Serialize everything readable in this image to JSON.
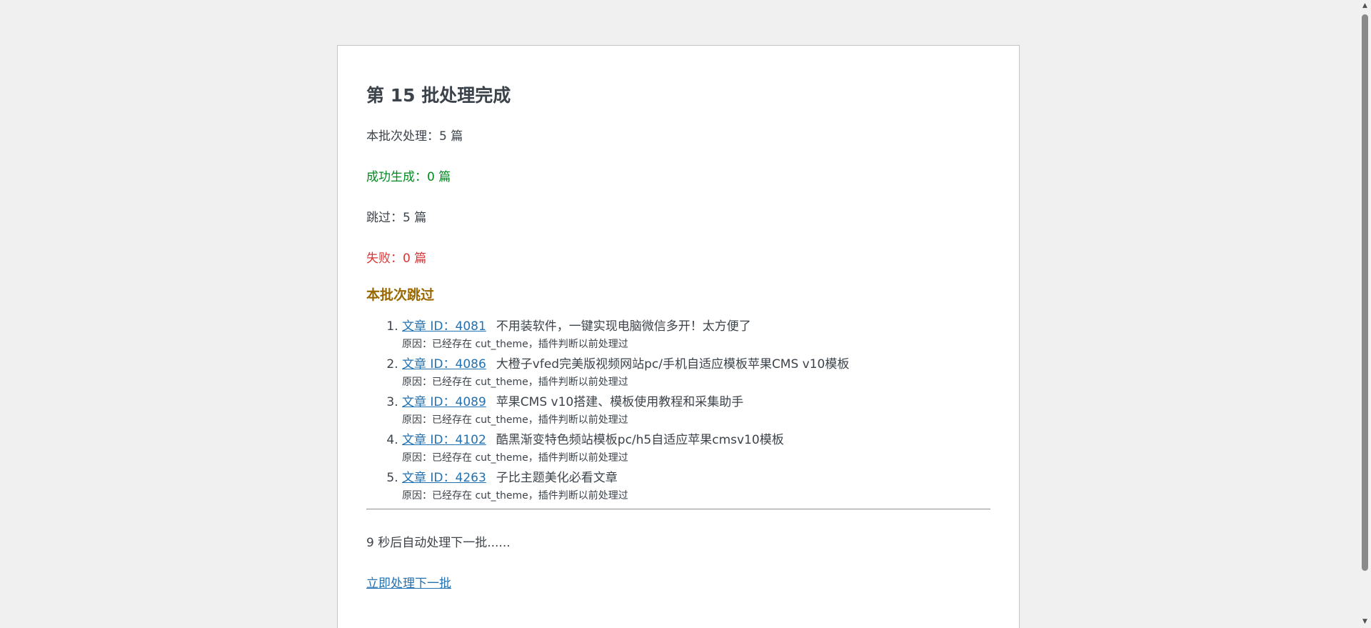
{
  "batch": {
    "title": "第 15 批处理完成",
    "processed": "本批次处理：5 篇",
    "success": "成功生成：0 篇",
    "skipped": "跳过：5 篇",
    "failed": "失败：0 篇"
  },
  "skip_section": {
    "title": "本批次跳过",
    "items": [
      {
        "link": "文章 ID：4081",
        "post_title": "不用装软件，一键实现电脑微信多开！太方便了",
        "reason": "原因：已经存在 cut_theme，插件判断以前处理过"
      },
      {
        "link": "文章 ID：4086",
        "post_title": "大橙子vfed完美版视频网站pc/手机自适应模板苹果CMS v10模板",
        "reason": "原因：已经存在 cut_theme，插件判断以前处理过"
      },
      {
        "link": "文章 ID：4089",
        "post_title": "苹果CMS v10搭建、模板使用教程和采集助手",
        "reason": "原因：已经存在 cut_theme，插件判断以前处理过"
      },
      {
        "link": "文章 ID：4102",
        "post_title": "酷黑渐变特色频站模板pc/h5自适应苹果cmsv10模板",
        "reason": "原因：已经存在 cut_theme，插件判断以前处理过"
      },
      {
        "link": "文章 ID：4263",
        "post_title": "子比主题美化必看文章",
        "reason": "原因：已经存在 cut_theme，插件判断以前处理过"
      }
    ]
  },
  "footer": {
    "countdown": "9 秒后自动处理下一批......",
    "next_link": "立即处理下一批"
  },
  "colors": {
    "success": "#008a20",
    "fail": "#d63638",
    "section_title": "#996800",
    "link": "#2271b1"
  },
  "icons": {
    "scroll_up": "scroll-up-arrow-icon",
    "scroll_down": "scroll-down-arrow-icon"
  }
}
